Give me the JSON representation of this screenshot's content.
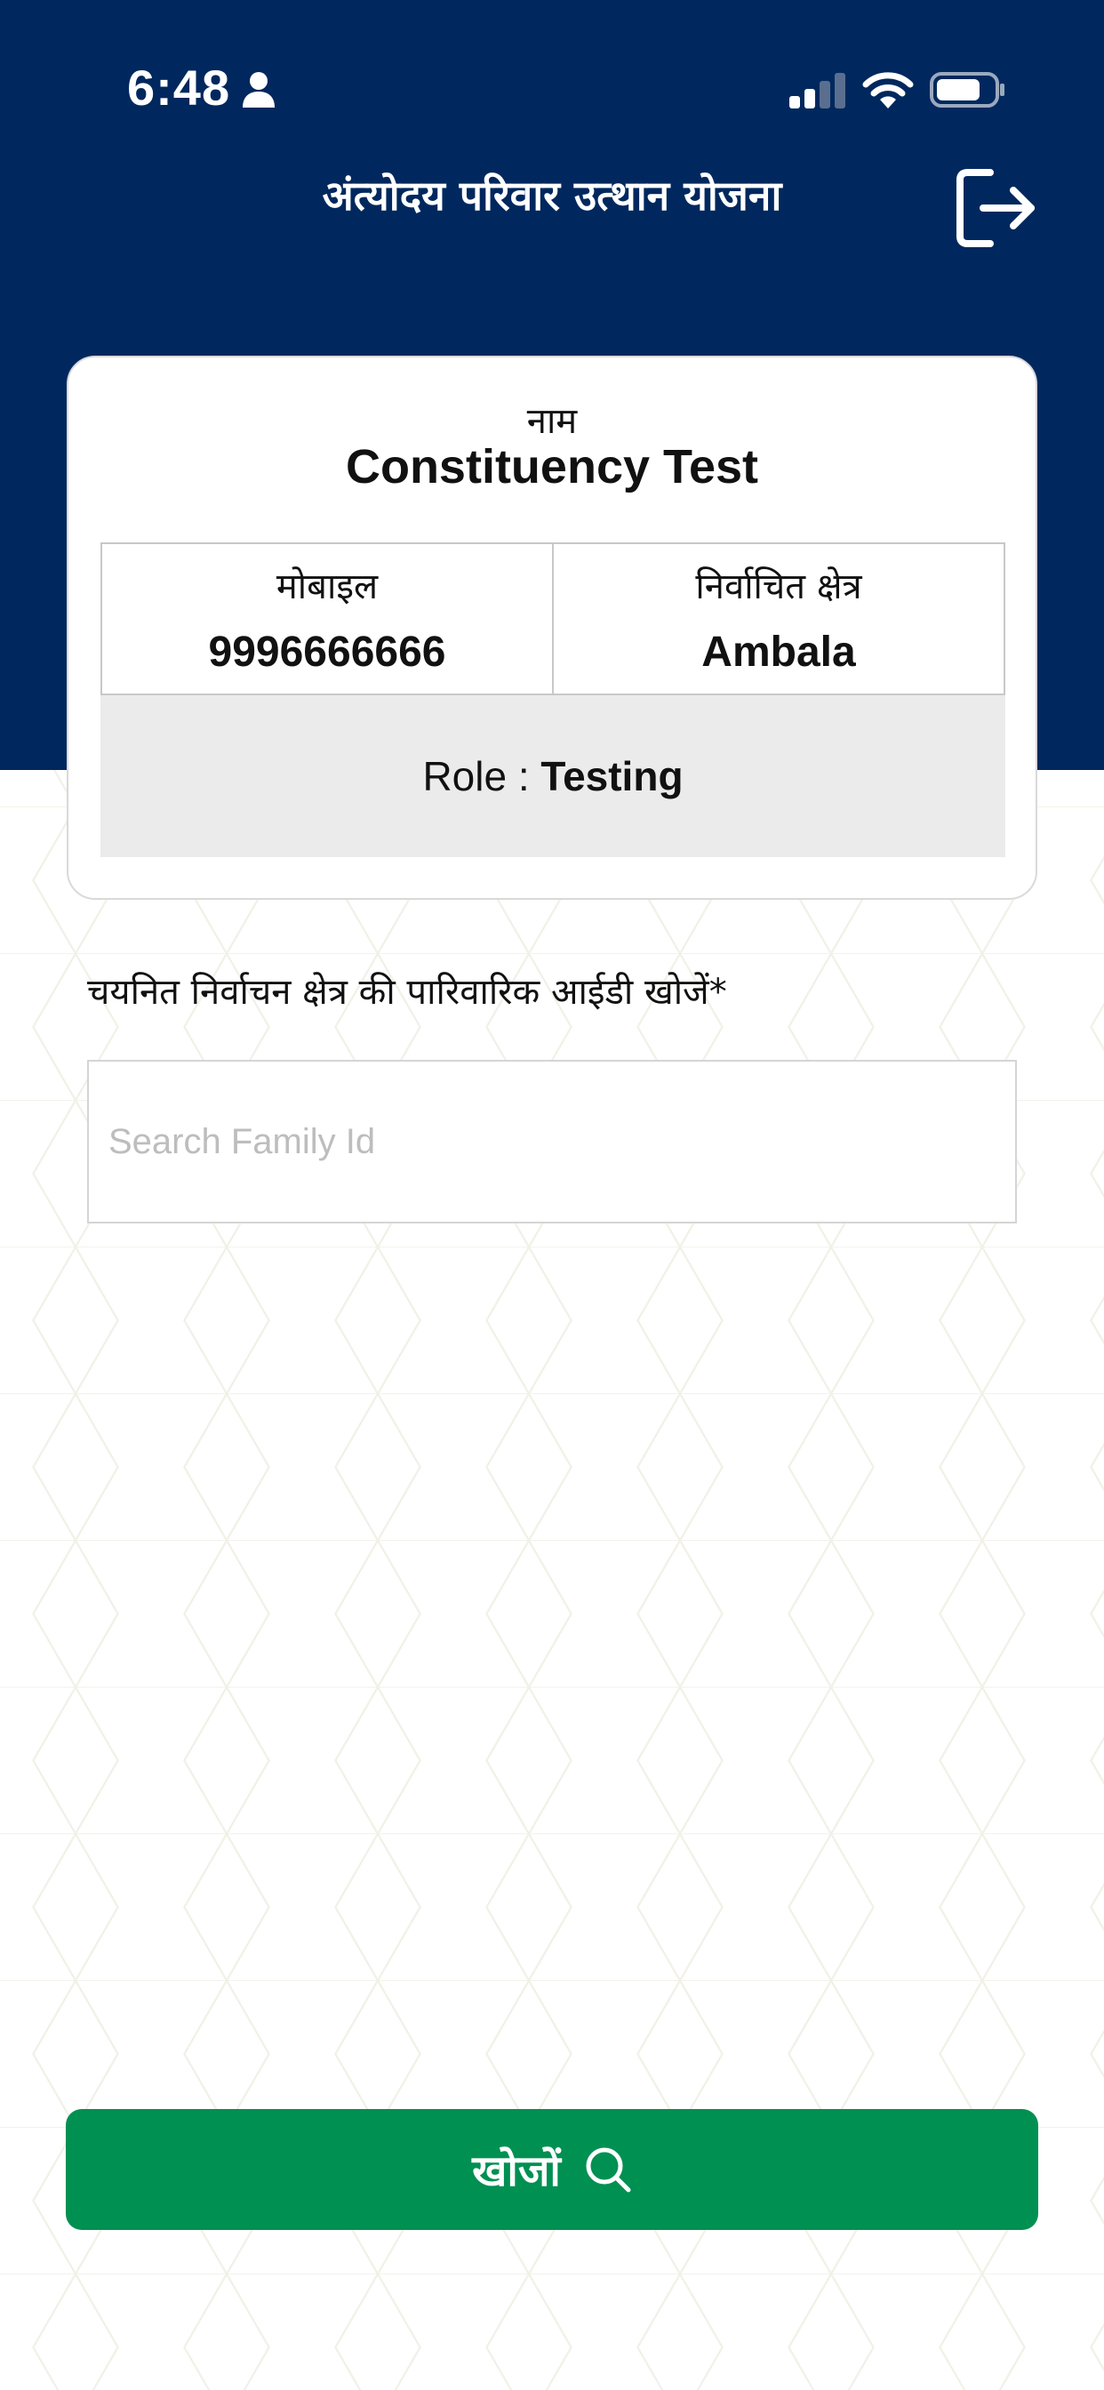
{
  "status_bar": {
    "time": "6:48"
  },
  "header": {
    "title": "अंत्योदय परिवार उत्थान योजना",
    "color": "#00285E"
  },
  "profile": {
    "name_label": "नाम",
    "name_value": "Constituency Test",
    "mobile_label": "मोबाइल",
    "mobile_value": "9996666666",
    "constituency_label": "निर्वाचित क्षेत्र",
    "constituency_value": "Ambala",
    "role_label": "Role : ",
    "role_value": "Testing"
  },
  "search": {
    "label": "चयनित निर्वाचन क्षेत्र की पारिवारिक आईडी खोजें*",
    "placeholder": "Search Family Id",
    "value": "",
    "button_label": "खोजों",
    "button_color": "#009052"
  },
  "icons": {
    "logout": "logout-icon",
    "search": "search-icon",
    "person": "person-icon",
    "signal": "signal-icon",
    "wifi": "wifi-icon",
    "battery": "battery-icon"
  }
}
